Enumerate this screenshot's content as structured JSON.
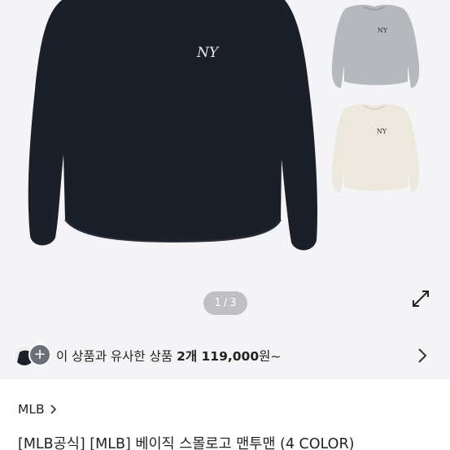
{
  "gallery": {
    "page_current": "1",
    "page_separator": "/",
    "page_total": "3",
    "logo_text": "NY",
    "colors": {
      "background": "#f4f4f6",
      "main_sweater": "#1b1f2a",
      "grey_sweater": "#b5b8bc",
      "cream_sweater": "#ece8dd",
      "logo_light": "#e9eaee"
    }
  },
  "similar_products": {
    "prefix": "이 상품과 유사한 상품 ",
    "count": "2개",
    "price": " 119,000",
    "suffix": "원~",
    "add_icon": "+"
  },
  "brand": {
    "name": "MLB"
  },
  "product": {
    "title": "[MLB공식] [MLB] 베이직 스몰로고 맨투맨 (4 COLOR)"
  }
}
